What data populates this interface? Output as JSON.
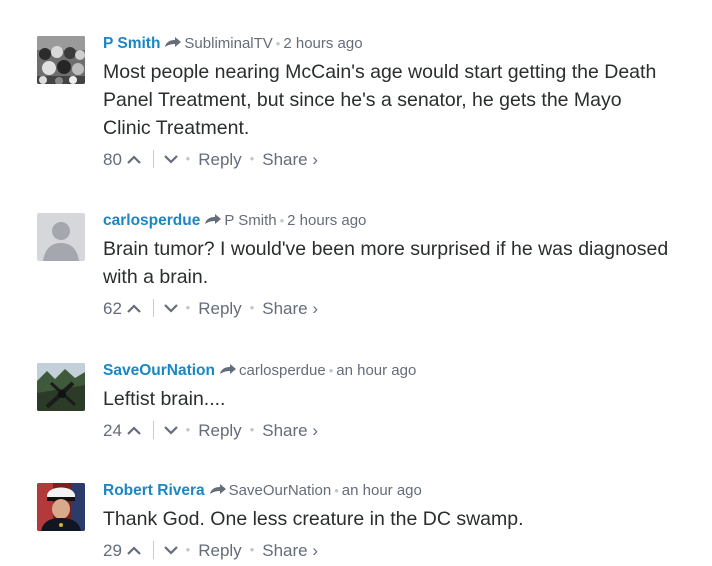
{
  "comments": [
    {
      "author": "P Smith",
      "parent": "SubliminalTV",
      "time": "2 hours ago",
      "text_lines": [
        "Most people nearing McCain's age would start getting the Death",
        "Panel Treatment, but since he's a senator, he gets the Mayo",
        "Clinic Treatment."
      ],
      "upvotes": "80",
      "reply_label": "Reply",
      "share_label": "Share ›",
      "avatar_icon": "crowd-photo-avatar"
    },
    {
      "author": "carlosperdue",
      "parent": "P Smith",
      "time": "2 hours ago",
      "text_lines": [
        "Brain tumor? I would've been more surprised if he was diagnosed",
        "with a brain."
      ],
      "upvotes": "62",
      "reply_label": "Reply",
      "share_label": "Share ›",
      "avatar_icon": "default-user-avatar"
    },
    {
      "author": "SaveOurNation",
      "parent": "carlosperdue",
      "time": "an hour ago",
      "text_lines": [
        "Leftist brain...."
      ],
      "upvotes": "24",
      "reply_label": "Reply",
      "share_label": "Share ›",
      "avatar_icon": "landscape-photo-avatar"
    },
    {
      "author": "Robert Rivera",
      "parent": "SaveOurNation",
      "time": "an hour ago",
      "text_lines": [
        "Thank God. One less creature in the DC swamp."
      ],
      "upvotes": "29",
      "reply_label": "Reply",
      "share_label": "Share ›",
      "avatar_icon": "marine-portrait-avatar"
    }
  ],
  "colors": {
    "author": "#1a87c5",
    "meta": "#656c7a",
    "text": "#2a2e2e"
  }
}
